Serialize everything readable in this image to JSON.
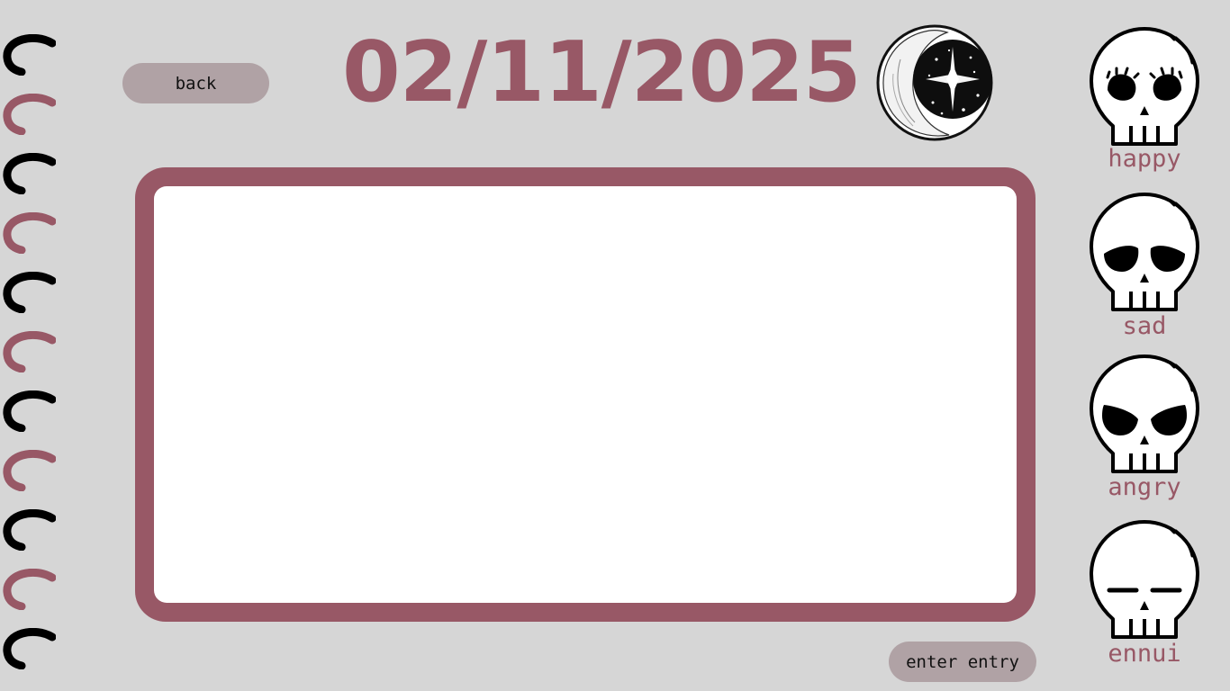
{
  "header": {
    "back_label": "back",
    "date": "02/11/2025"
  },
  "entry": {
    "value": "",
    "placeholder": ""
  },
  "footer": {
    "enter_label": "enter entry"
  },
  "moods": [
    {
      "label": "happy",
      "icon": "happy-skull-icon"
    },
    {
      "label": "sad",
      "icon": "sad-skull-icon"
    },
    {
      "label": "angry",
      "icon": "angry-skull-icon"
    },
    {
      "label": "ennui",
      "icon": "ennui-skull-icon"
    }
  ],
  "colors": {
    "accent": "#985866",
    "background": "#d6d6d6",
    "button": "#b0a2a5",
    "ring_dark": "#000000",
    "ring_accent": "#985866"
  },
  "icons": {
    "binding": "spiral-ring-icon",
    "moon": "moon-star-icon"
  }
}
